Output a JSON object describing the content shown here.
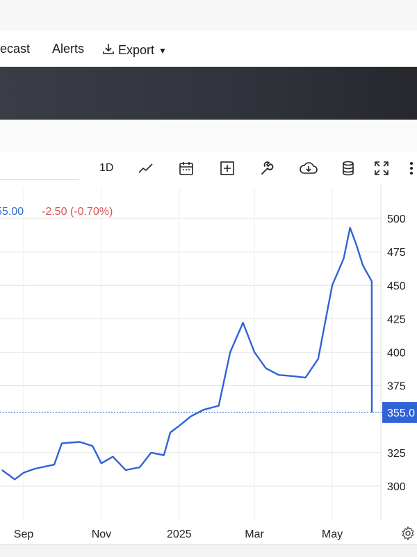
{
  "tabs": {
    "forecast": "recast",
    "alerts": "Alerts",
    "export": "Export"
  },
  "toolbar": {
    "interval": "1D"
  },
  "quote": {
    "last": "55.00",
    "change": "-2.50 (-0.70%)",
    "current_label": "355.0"
  },
  "chart_data": {
    "type": "line",
    "x": [
      "2024-08-15",
      "2024-08-25",
      "2024-09-01",
      "2024-09-10",
      "2024-09-20",
      "2024-09-25",
      "2024-10-01",
      "2024-10-15",
      "2024-10-25",
      "2024-11-01",
      "2024-11-10",
      "2024-11-20",
      "2024-12-01",
      "2024-12-10",
      "2024-12-20",
      "2024-12-25",
      "2025-01-01",
      "2025-01-10",
      "2025-01-20",
      "2025-02-01",
      "2025-02-10",
      "2025-02-20",
      "2025-03-01",
      "2025-03-10",
      "2025-03-20",
      "2025-04-01",
      "2025-04-10",
      "2025-04-20",
      "2025-05-01",
      "2025-05-10",
      "2025-05-15",
      "2025-05-20",
      "2025-05-25",
      "2025-06-01",
      "2025-06-05",
      "2025-06-10"
    ],
    "values": [
      312,
      305,
      310,
      313,
      315,
      316,
      332,
      333,
      330,
      317,
      322,
      312,
      314,
      325,
      323,
      340,
      345,
      352,
      357,
      360,
      400,
      422,
      400,
      388,
      383,
      382,
      381,
      395,
      450,
      470,
      493,
      480,
      465,
      453,
      360,
      355
    ],
    "y_ticks": [
      "500",
      "475",
      "450",
      "425",
      "400",
      "375",
      "325",
      "300"
    ],
    "x_ticks": [
      "Sep",
      "Nov",
      "2025",
      "Mar",
      "May"
    ],
    "ylim": [
      280,
      510
    ],
    "current_price": 355,
    "line_color": "#2f63d6",
    "grid": true
  }
}
